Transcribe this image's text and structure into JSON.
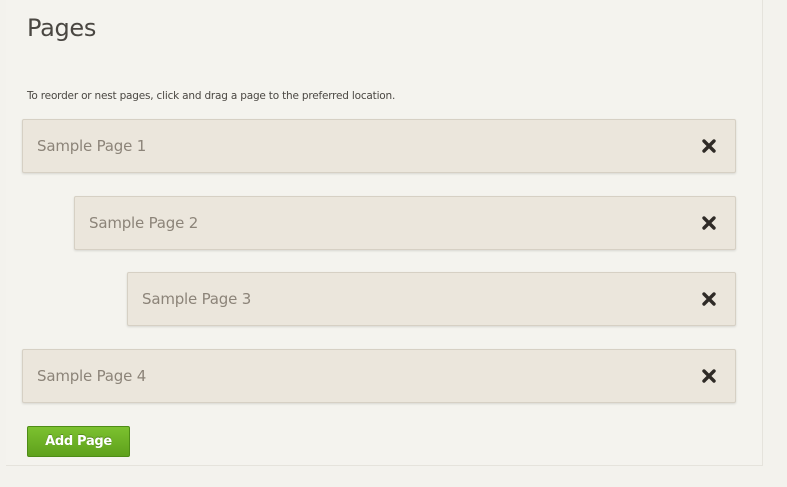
{
  "page": {
    "title": "Pages",
    "instructions": "To reorder or nest pages, click and drag a page to the preferred location."
  },
  "pages": [
    {
      "label": "Sample Page 1",
      "nesting_level": 0,
      "delete_icon": "close-x-icon"
    },
    {
      "label": "Sample Page 2",
      "nesting_level": 1,
      "delete_icon": "close-x-icon"
    },
    {
      "label": "Sample Page 3",
      "nesting_level": 2,
      "delete_icon": "close-x-icon"
    },
    {
      "label": "Sample Page 4",
      "nesting_level": 0,
      "delete_icon": "close-x-icon"
    }
  ],
  "actions": {
    "add_page_label": "Add Page"
  },
  "colors": {
    "background": "#f3f2ed",
    "item_background": "#ebe6dc",
    "item_text": "#8c8479",
    "heading_text": "#4a4742",
    "delete_icon": "#2f2b27",
    "add_button": "#6aaf24"
  }
}
